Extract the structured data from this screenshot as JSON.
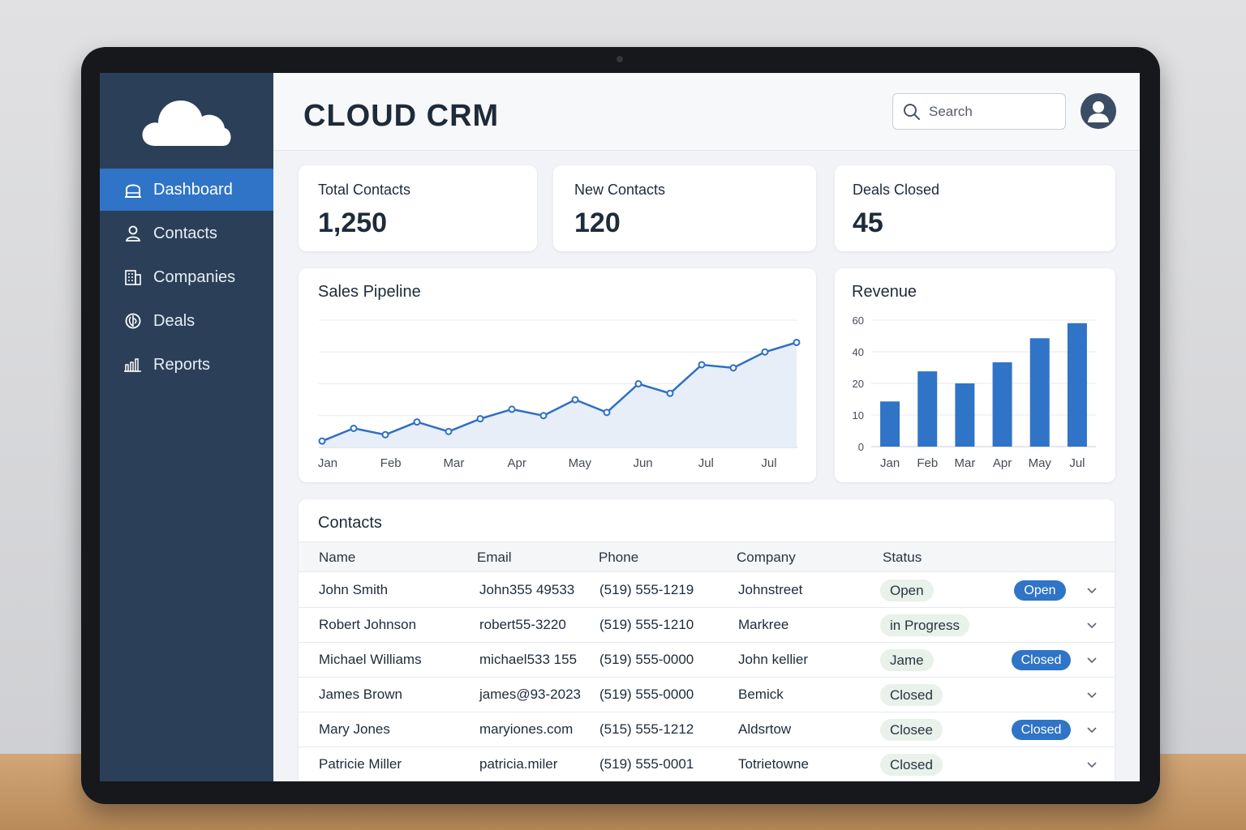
{
  "app": {
    "title": "CLOUD CRM"
  },
  "sidebar": {
    "items": [
      {
        "label": "Dashboard",
        "icon": "home-icon",
        "active": true
      },
      {
        "label": "Contacts",
        "icon": "user-icon",
        "active": false
      },
      {
        "label": "Companies",
        "icon": "building-icon",
        "active": false
      },
      {
        "label": "Deals",
        "icon": "deals-icon",
        "active": false
      },
      {
        "label": "Reports",
        "icon": "bar-chart-icon",
        "active": false
      }
    ]
  },
  "search": {
    "placeholder": "Search",
    "icon": "search-icon"
  },
  "stats": [
    {
      "label": "Total Contacts",
      "value": "1,250"
    },
    {
      "label": "New Contacts",
      "value": "120"
    },
    {
      "label": "Deals Closed",
      "value": "45"
    }
  ],
  "colors": {
    "accent": "#2f74c6",
    "sidebar": "#2b4058",
    "status_pill": "#e8f1ea"
  },
  "chart_data": [
    {
      "type": "area",
      "title": "Sales Pipeline",
      "categories": [
        "Jan",
        "Feb",
        "Mar",
        "Apr",
        "May",
        "Jun",
        "Jul",
        "Jul"
      ],
      "values": [
        2,
        6,
        4,
        8,
        5,
        9,
        12,
        10,
        15,
        11,
        20,
        17,
        26,
        25,
        30,
        33
      ],
      "ylim": [
        0,
        40
      ],
      "grid": true
    },
    {
      "type": "bar",
      "title": "Revenue",
      "categories": [
        "Jan",
        "Feb",
        "Mar",
        "Apr",
        "May",
        "Jul"
      ],
      "y_ticks": [
        "60",
        "40",
        "20",
        "10",
        "0"
      ],
      "values": [
        15,
        25,
        21,
        28,
        36,
        41
      ],
      "ylim": [
        0,
        42
      ],
      "grid": true
    }
  ],
  "contacts": {
    "title": "Contacts",
    "columns": [
      "Name",
      "Email",
      "Phone",
      "Company",
      "Status"
    ],
    "rows": [
      {
        "name": "John Smith",
        "email": "John355 49533",
        "phone": "(519) 555-1219",
        "company": "Johnstreet",
        "status": "Open",
        "badge": "Open"
      },
      {
        "name": "Robert Johnson",
        "email": "robert55-3220",
        "phone": "(519) 555-1210",
        "company": "Markree",
        "status": "in Progress",
        "badge": ""
      },
      {
        "name": "Michael Williams",
        "email": "michael533 155",
        "phone": "(519) 555-0000",
        "company": "John kellier",
        "status": "Jame",
        "badge": "Closed"
      },
      {
        "name": "James Brown",
        "email": "james@93-2023",
        "phone": "(519) 555-0000",
        "company": "Bemick",
        "status": "Closed",
        "badge": ""
      },
      {
        "name": "Mary Jones",
        "email": "maryiones.com",
        "phone": "(515) 555-1212",
        "company": "Aldsrtow",
        "status": "Closee",
        "badge": "Closed"
      },
      {
        "name": "Patricie Miller",
        "email": "patricia.miler",
        "phone": "(519) 555-0001",
        "company": "Totrietowne",
        "status": "Closed",
        "badge": ""
      }
    ]
  }
}
